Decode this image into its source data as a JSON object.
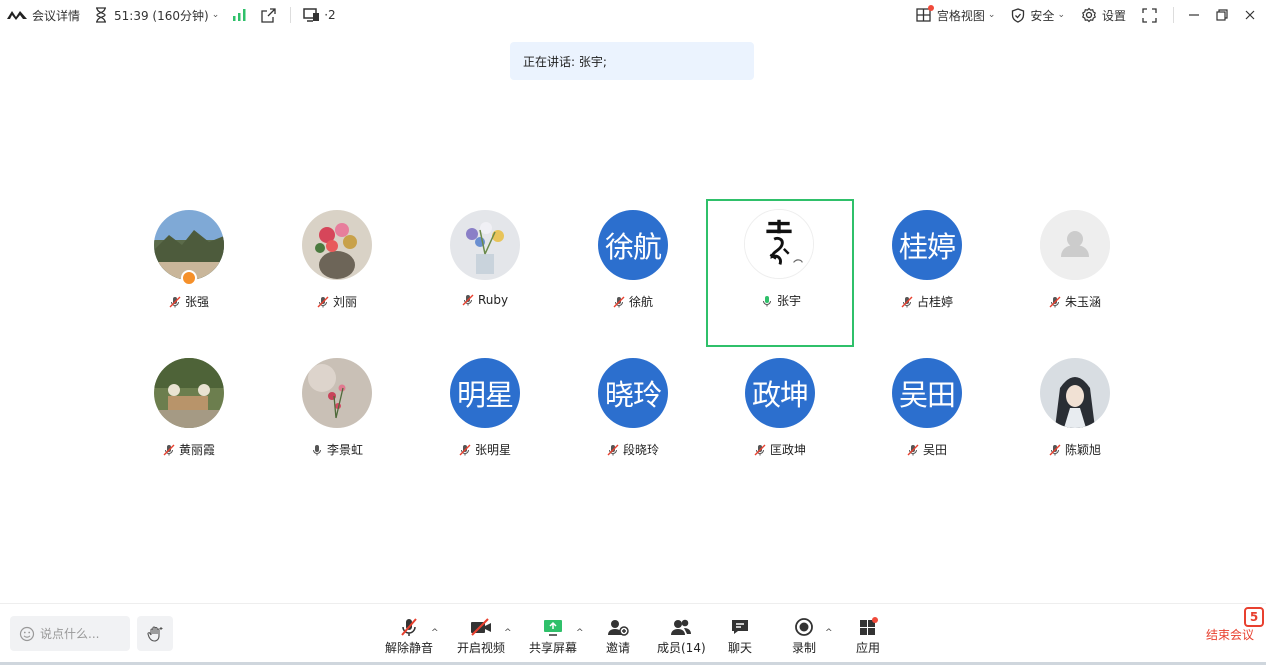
{
  "topbar": {
    "meeting_details": "会议详情",
    "timer": "51:39 (160分钟)",
    "screen_count": "·2",
    "view_mode": "宫格视图",
    "security": "安全",
    "settings": "设置"
  },
  "speaking_label": "正在讲话: 张宇;",
  "participants": [
    {
      "name": "张强"
    },
    {
      "name": "刘丽"
    },
    {
      "name": "Ruby"
    },
    {
      "name": "徐航",
      "avatar_text": "徐航"
    },
    {
      "name": "张宇"
    },
    {
      "name": "占桂婷",
      "avatar_text": "桂婷"
    },
    {
      "name": "朱玉涵"
    },
    {
      "name": "黄丽霞"
    },
    {
      "name": "李景虹"
    },
    {
      "name": "张明星",
      "avatar_text": "明星"
    },
    {
      "name": "段晓玲",
      "avatar_text": "晓玲"
    },
    {
      "name": "匡政坤",
      "avatar_text": "政坤"
    },
    {
      "name": "吴田",
      "avatar_text": "吴田"
    },
    {
      "name": "陈颖旭"
    }
  ],
  "bottombar": {
    "chat_placeholder": "说点什么...",
    "unmute": "解除静音",
    "start_video": "开启视频",
    "share_screen": "共享屏幕",
    "invite": "邀请",
    "members": "成员(14)",
    "chat": "聊天",
    "record": "录制",
    "apps": "应用",
    "end_meeting": "结束会议",
    "end_badge": "5"
  },
  "colors": {
    "accent_blue": "#2c6fce",
    "speaking_green": "#2fc06a",
    "end_red": "#e8402f",
    "signal_green": "#2fc06a"
  }
}
